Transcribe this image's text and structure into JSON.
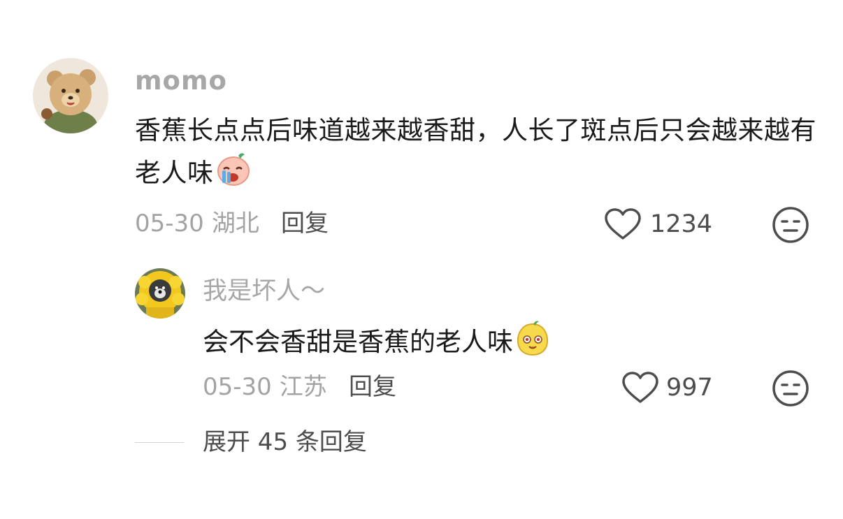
{
  "comment": {
    "username": "momo",
    "text": "香蕉长点点后味道越来越香甜，人长了斑点后只会越来越有老人味",
    "emoji": "crying-face-emoji",
    "date": "05-30",
    "location": "湖北",
    "reply_label": "回复",
    "like_count": "1234"
  },
  "reply": {
    "username": "我是坏人～",
    "text": "会不会香甜是香蕉的老人味",
    "emoji": "smiling-bean-emoji",
    "date": "05-30",
    "location": "江苏",
    "reply_label": "回复",
    "like_count": "997"
  },
  "expand_label": "展开 45 条回复",
  "colors": {
    "username": "#a7a7a7",
    "meta": "#a3a3a3",
    "action": "#4d4d4d",
    "text": "#1a1a1a",
    "divider": "#d6d6d6"
  }
}
